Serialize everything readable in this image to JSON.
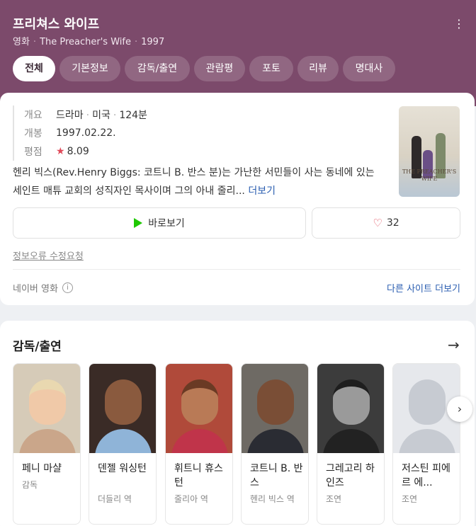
{
  "header": {
    "title": "프리쳐스 와이프",
    "genre": "영화",
    "original_title": "The Preacher's Wife",
    "year": "1997",
    "tabs": [
      {
        "label": "전체",
        "active": true
      },
      {
        "label": "기본정보"
      },
      {
        "label": "감독/출연"
      },
      {
        "label": "관람평"
      },
      {
        "label": "포토"
      },
      {
        "label": "리뷰"
      },
      {
        "label": "명대사"
      }
    ]
  },
  "info": {
    "summary_label": "개요",
    "summary_genre": "드라마",
    "summary_country": "미국",
    "summary_runtime": "124분",
    "release_label": "개봉",
    "release_date": "1997.02.22.",
    "rating_label": "평점",
    "rating": "8.09",
    "description": "헨리 빅스(Rev.Henry Biggs: 코트니 B. 반스 분)는 가난한 서민들이 사는 동네에 있는 세인트 매튜 교회의 성직자인 목사이며 그의 아내 줄리...",
    "more_label": "더보기",
    "poster_title": "THE PREACHER'S WIFE"
  },
  "actions": {
    "watch_label": "바로보기",
    "like_count": "32",
    "report_label": "정보오류 수정요청",
    "source_label": "네이버 영화",
    "other_sites_label": "다른 사이트 더보기"
  },
  "cast_section": {
    "title": "감독/출연",
    "people": [
      {
        "name": "페니 마샬",
        "role": "감독"
      },
      {
        "name": "덴젤 워싱턴",
        "role": "더들리 역"
      },
      {
        "name": "휘트니 휴스턴",
        "role": "줄리아 역"
      },
      {
        "name": "코트니 B. 반스",
        "role": "헨리 빅스 역"
      },
      {
        "name": "그레고리 하인즈",
        "role": "조연"
      },
      {
        "name": "저스틴 피에르 에...",
        "role": "조연"
      }
    ]
  },
  "colors": {
    "header_bg": "#7c4a6b",
    "link": "#2a5db0",
    "star": "#e04a5a",
    "play": "#1ec800"
  }
}
